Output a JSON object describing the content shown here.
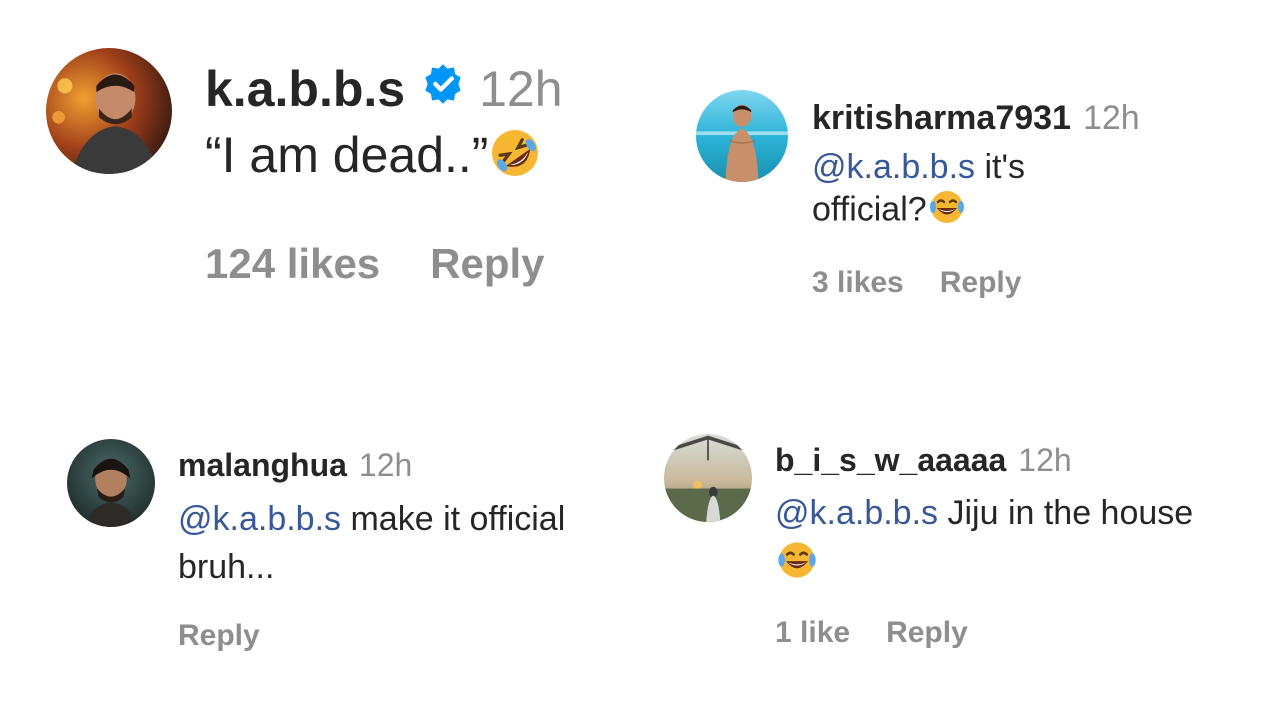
{
  "comments": [
    {
      "username": "k.a.b.b.s",
      "verified": true,
      "time": "12h",
      "text": "“I am dead..”",
      "emoji": "rolling-on-floor-laughing",
      "likes": "124 likes",
      "reply": "Reply"
    },
    {
      "username": "kritisharma7931",
      "time": "12h",
      "mention": "@k.a.b.b.s",
      "text": " it's official?",
      "emoji": "face-with-tears-of-joy",
      "likes": "3 likes",
      "reply": "Reply"
    },
    {
      "username": "malanghua",
      "time": "12h",
      "mention": "@k.a.b.b.s",
      "text": " make it official bruh...",
      "reply": "Reply"
    },
    {
      "username": "b_i_s_w_aaaaa",
      "time": "12h",
      "mention": "@k.a.b.b.s",
      "text": " Jiju in the house",
      "emoji": "face-with-tears-of-joy",
      "likes": "1 like",
      "reply": "Reply"
    }
  ],
  "colors": {
    "text": "#262626",
    "muted": "#8e8e8e",
    "mention": "#385898",
    "verified": "#0095f6"
  }
}
